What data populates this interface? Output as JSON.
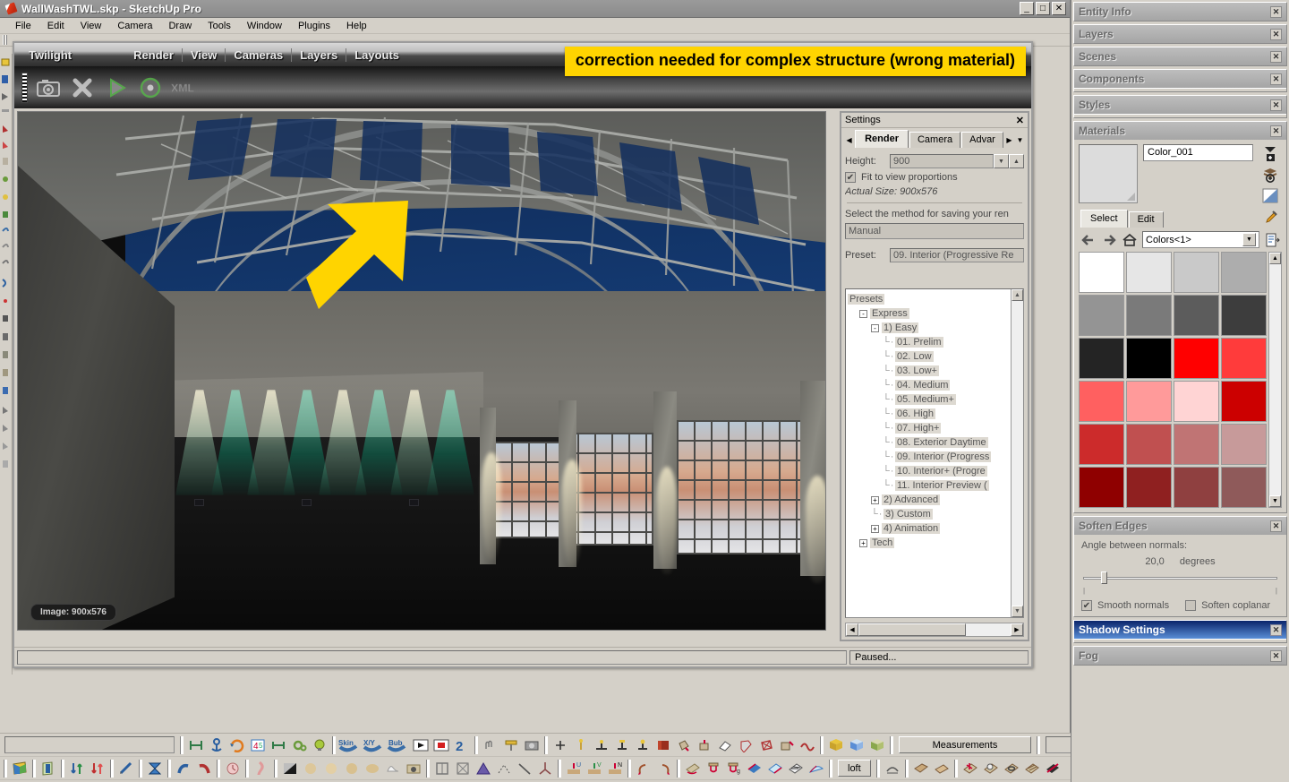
{
  "window": {
    "title": "WallWashTWL.skp - SketchUp Pro",
    "minimize": "_",
    "maximize": "□",
    "close": "✕"
  },
  "menubar": [
    "File",
    "Edit",
    "View",
    "Camera",
    "Draw",
    "Tools",
    "Window",
    "Plugins",
    "Help"
  ],
  "render_window": {
    "brand": "Twilight",
    "menus": [
      "Render",
      "View",
      "Cameras",
      "Layers",
      "Layouts"
    ],
    "close": "✕",
    "toolbar_icons": [
      "camera-render-icon",
      "stop-render-icon",
      "play-render-icon",
      "disc-render-icon",
      "xml-export-icon"
    ],
    "image_badge": "Image: 900x576",
    "status": "Paused..."
  },
  "annotation": {
    "text": "correction needed for complex structure (wrong material)",
    "color": "#ffd400"
  },
  "settings": {
    "title": "Settings",
    "close": "✕",
    "prev_arrow": "◀",
    "next_arrow": "▶",
    "menu_arrow": "▼",
    "tabs": [
      {
        "label": "Render",
        "active": true
      },
      {
        "label": "Camera",
        "active": false
      },
      {
        "label": "Advar",
        "active": false
      }
    ],
    "height_label": "Height:",
    "height_value": "900",
    "fit_checkbox_label": "Fit to view proportions",
    "fit_checked": "✔",
    "actual_size": "Actual Size: 900x576",
    "save_method_label": "Select the method for saving your ren",
    "save_method_value": "Manual",
    "preset_label": "Preset:",
    "preset_value": "09. Interior (Progressive Re",
    "tree": [
      {
        "label": "Presets",
        "indent": 0,
        "box": ""
      },
      {
        "label": "Express",
        "indent": 1,
        "box": "-"
      },
      {
        "label": "1) Easy",
        "indent": 2,
        "box": "-"
      },
      {
        "label": "01. Prelim",
        "indent": 3,
        "box": ""
      },
      {
        "label": "02. Low",
        "indent": 3,
        "box": ""
      },
      {
        "label": "03. Low+",
        "indent": 3,
        "box": ""
      },
      {
        "label": "04. Medium",
        "indent": 3,
        "box": ""
      },
      {
        "label": "05. Medium+",
        "indent": 3,
        "box": ""
      },
      {
        "label": "06. High",
        "indent": 3,
        "box": ""
      },
      {
        "label": "07. High+",
        "indent": 3,
        "box": ""
      },
      {
        "label": "08. Exterior Daytime",
        "indent": 3,
        "box": ""
      },
      {
        "label": "09. Interior (Progress",
        "indent": 3,
        "box": ""
      },
      {
        "label": "10. Interior+ (Progre",
        "indent": 3,
        "box": ""
      },
      {
        "label": "11. Interior Preview (",
        "indent": 3,
        "box": ""
      },
      {
        "label": "2) Advanced",
        "indent": 2,
        "box": "+"
      },
      {
        "label": "3) Custom",
        "indent": 2,
        "box": ""
      },
      {
        "label": "4) Animation",
        "indent": 2,
        "box": "+"
      },
      {
        "label": "Tech",
        "indent": 1,
        "box": "+"
      }
    ],
    "scroll_up": "▲",
    "scroll_down": "▼",
    "scroll_left": "◀",
    "scroll_right": "▶"
  },
  "tray": {
    "panels": [
      {
        "title": "Entity Info",
        "active": false
      },
      {
        "title": "Layers",
        "active": false
      },
      {
        "title": "Scenes",
        "active": false
      },
      {
        "title": "Components",
        "active": false
      },
      {
        "title": "Styles",
        "active": false
      }
    ],
    "materials": {
      "title": "Materials",
      "close": "✕",
      "name": "Color_001",
      "tabs": [
        {
          "label": "Select",
          "active": true
        },
        {
          "label": "Edit",
          "active": false
        }
      ],
      "back_arrow": "←",
      "forward_arrow": "→",
      "home_icon": "home-icon",
      "library": "Colors<1>",
      "dropdown_arrow": "▼",
      "scroll_up": "▲",
      "scroll_down": "▼",
      "side_icons": [
        "create-material-icon",
        "add-to-model-icon",
        "display-secondary-icon"
      ],
      "eyedropper_icon": "eyedropper-icon",
      "details_icon": "details-icon",
      "swatches": [
        "#ffffff",
        "#e6e6e6",
        "#c9c9c9",
        "#adadad",
        "#949494",
        "#7a7a7a",
        "#5c5c5c",
        "#3d3d3d",
        "#242424",
        "#000000",
        "#ff0000",
        "#ff3b3b",
        "#ff6060",
        "#ff9a9a",
        "#ffd4d4",
        "#cc0000",
        "#cc2b2b",
        "#c05050",
        "#c07474",
        "#c79a9a",
        "#8f0000",
        "#8f2020",
        "#8f4040",
        "#8f5a5a"
      ]
    },
    "soften_edges": {
      "title": "Soften Edges",
      "close": "✕",
      "angle_label": "Angle between normals:",
      "angle_value": "20,0",
      "angle_unit": "degrees",
      "smooth_normals_label": "Smooth normals",
      "smooth_normals_checked": "✔",
      "soften_coplanar_label": "Soften coplanar",
      "soften_coplanar_checked": ""
    },
    "shadow_settings": {
      "title": "Shadow Settings",
      "close": "✕",
      "active": true
    },
    "fog": {
      "title": "Fog",
      "close": "✕",
      "active": false
    }
  },
  "bottom_toolbar": {
    "measurements_label": "Measurements",
    "loft_label": "loft",
    "row1_icons": [
      "align-icon",
      "anchor-icon",
      "rotate-arrows-icon",
      "counter-icon",
      "stretch-icon",
      "gears-icon",
      "bulb-icon",
      "skin-icon",
      "xy-icon",
      "bub-icon",
      "play-icon",
      "stop-icon",
      "curve-icon",
      "hand-icon",
      "tag-icon",
      "camera-icon"
    ],
    "row1b_icons": [
      "plus-icon",
      "axis-light-icon",
      "spot-light-icon",
      "area-light-icon",
      "point-light-icon",
      "book-icon",
      "paint-pour-icon",
      "paint-bucket-icon",
      "eraser-icon",
      "solid-icon",
      "mesh-icon",
      "stamp-icon",
      "wave-icon",
      "cube-yellow-icon",
      "cube-blue-icon",
      "cube-green-icon"
    ],
    "row2_icons": [
      "plane-icon",
      "face-icon",
      "updown-icon",
      "downup-icon",
      "pencil-icon",
      "hourglass-icon",
      "arc-blue-icon",
      "arc-red-icon",
      "clock-icon",
      "leg-icon",
      "gradient-icon",
      "sphere1-icon",
      "sphere2-icon",
      "sphere3-icon",
      "sphere4-icon",
      "cloth-icon",
      "sandbox-icon",
      "mirror-icon"
    ],
    "row2b_icons": [
      "cage-icon",
      "pyramid-icon",
      "triangle-icon",
      "points-icon",
      "line-icon",
      "tripod-icon",
      "u-light-icon",
      "v-light-icon",
      "n-light-icon",
      "rotate-left-icon",
      "rotate-right-icon",
      "terrain-icon",
      "drape-u-icon",
      "drape-ug-icon",
      "fold-blue-icon",
      "fold-cyan-icon",
      "checker-icon",
      "fan-icon",
      "arc2-icon",
      "plank1-icon",
      "plank2-icon",
      "star-plank-icon",
      "globe-plank-icon",
      "ring-plank-icon",
      "grid-plank-icon",
      "cross-plank-icon"
    ]
  }
}
